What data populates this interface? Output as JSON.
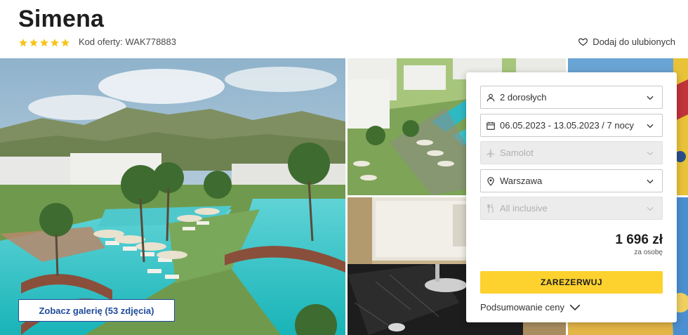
{
  "hotel": {
    "name": "Simena",
    "stars": 5,
    "offer_code": "Kod oferty: WAK778883",
    "favorite_label": "Dodaj do ulubionych"
  },
  "gallery": {
    "button_label": "Zobacz galerię (53 zdjęcia)"
  },
  "booking": {
    "travelers": "2 dorosłych",
    "dates": "06.05.2023 - 13.05.2023 / 7 nocy",
    "transport": "Samolot",
    "departure": "Warszawa",
    "board": "All inclusive",
    "price": "1 696 zł",
    "price_note": "za osobę",
    "book_label": "ZAREZERWUJ",
    "summary_label": "Podsumowanie ceny"
  },
  "colors": {
    "star": "#f7c419",
    "book_button": "#fdd12e",
    "gallery_button": "#1f4b9b"
  },
  "icons": [
    "star-icon",
    "heart-icon",
    "user-icon",
    "calendar-icon",
    "plane-icon",
    "location-pin-icon",
    "cutlery-icon",
    "chevron-down-icon"
  ]
}
